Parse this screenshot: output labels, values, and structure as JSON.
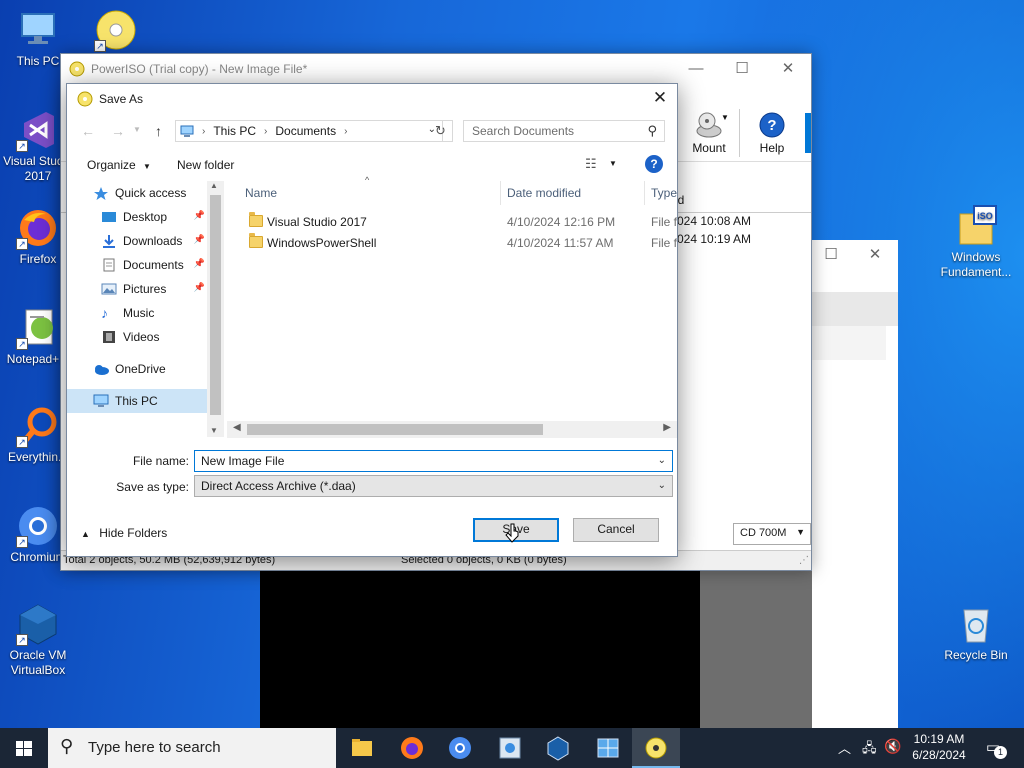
{
  "desktop": {
    "icons": [
      {
        "label": "This PC"
      },
      {
        "label": ""
      },
      {
        "label": "Visual Studio 2017"
      },
      {
        "label": "Firefox"
      },
      {
        "label": "Notepad+..."
      },
      {
        "label": "Everythin..."
      },
      {
        "label": "Chromium"
      },
      {
        "label": "Oracle VM VirtualBox"
      },
      {
        "label": "Windows Fundament..."
      },
      {
        "label": "Recycle Bin"
      }
    ]
  },
  "poweriso": {
    "title": "PowerISO (Trial copy) - New Image File*",
    "toolbar": {
      "mount_label": "Mount",
      "help_label": "Help"
    },
    "list_header_fragment": "ed",
    "list_dates": [
      "024 10:08 AM",
      "024 10:19 AM"
    ],
    "status_total": "Total 2 objects, 50.2 MB (52,639,912 bytes)",
    "status_selected": "Selected 0 objects, 0 KB (0 bytes)",
    "media_select": "CD 700M"
  },
  "saveas": {
    "title": "Save As",
    "breadcrumb": [
      "This PC",
      "Documents"
    ],
    "search_placeholder": "Search Documents",
    "organize_label": "Organize",
    "new_folder_label": "New folder",
    "nav_items": [
      {
        "label": "Quick access",
        "pinned": false
      },
      {
        "label": "Desktop",
        "pinned": true
      },
      {
        "label": "Downloads",
        "pinned": true
      },
      {
        "label": "Documents",
        "pinned": true
      },
      {
        "label": "Pictures",
        "pinned": true
      },
      {
        "label": "Music",
        "pinned": false
      },
      {
        "label": "Videos",
        "pinned": false
      },
      {
        "label": "OneDrive",
        "pinned": false
      },
      {
        "label": "This PC",
        "pinned": false,
        "selected": true
      }
    ],
    "columns": [
      "Name",
      "Date modified",
      "Type"
    ],
    "files": [
      {
        "name": "Visual Studio 2017",
        "date": "4/10/2024 12:16 PM",
        "type": "File f"
      },
      {
        "name": "WindowsPowerShell",
        "date": "4/10/2024 11:57 AM",
        "type": "File f"
      }
    ],
    "file_name_label": "File name:",
    "file_name_value": "New Image File",
    "save_type_label": "Save as type:",
    "save_type_value": "Direct Access Archive (*.daa)",
    "hide_folders_label": "Hide Folders",
    "save_label": "Save",
    "cancel_label": "Cancel"
  },
  "taskbar": {
    "search_placeholder": "Type here to search",
    "time": "10:19 AM",
    "date": "6/28/2024",
    "notification_count": "1"
  },
  "colors": {
    "accent": "#0078d7",
    "selection": "#cce4f7",
    "taskbar": "#1b2636",
    "folder": "#f6d36a"
  }
}
